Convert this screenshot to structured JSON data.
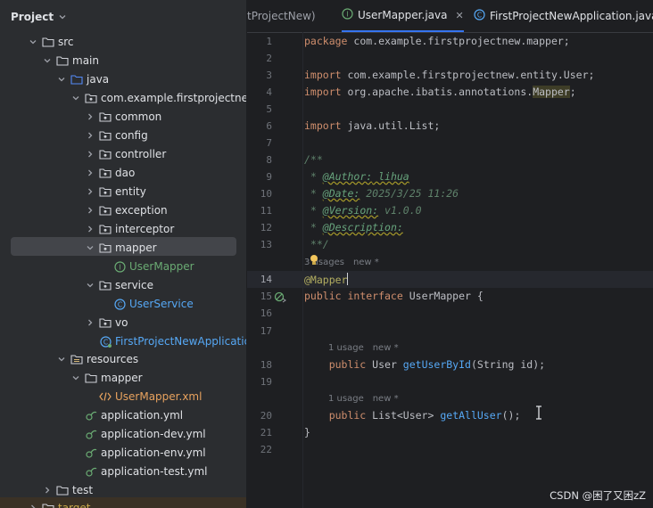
{
  "project": {
    "title": "Project",
    "tree": [
      {
        "label": "src",
        "kind": "folder",
        "expanded": true
      },
      {
        "label": "main",
        "kind": "folder",
        "expanded": true
      },
      {
        "label": "java",
        "kind": "source-folder",
        "expanded": true
      },
      {
        "label": "com.example.firstprojectnew",
        "kind": "package",
        "expanded": true
      },
      {
        "label": "common",
        "kind": "package",
        "expanded": false
      },
      {
        "label": "config",
        "kind": "package",
        "expanded": false
      },
      {
        "label": "controller",
        "kind": "package",
        "expanded": false
      },
      {
        "label": "dao",
        "kind": "package",
        "expanded": false
      },
      {
        "label": "entity",
        "kind": "package",
        "expanded": false
      },
      {
        "label": "exception",
        "kind": "package",
        "expanded": false
      },
      {
        "label": "interceptor",
        "kind": "package",
        "expanded": false
      },
      {
        "label": "mapper",
        "kind": "package",
        "expanded": true
      },
      {
        "label": "UserMapper",
        "kind": "interface"
      },
      {
        "label": "service",
        "kind": "package",
        "expanded": true
      },
      {
        "label": "UserService",
        "kind": "class"
      },
      {
        "label": "vo",
        "kind": "package",
        "expanded": false
      },
      {
        "label": "FirstProjectNewApplication",
        "kind": "app-class"
      },
      {
        "label": "resources",
        "kind": "resources-folder",
        "expanded": true
      },
      {
        "label": "mapper",
        "kind": "folder",
        "expanded": true
      },
      {
        "label": "UserMapper.xml",
        "kind": "xml"
      },
      {
        "label": "application.yml",
        "kind": "yml"
      },
      {
        "label": "application-dev.yml",
        "kind": "yml"
      },
      {
        "label": "application-env.yml",
        "kind": "yml"
      },
      {
        "label": "application-test.yml",
        "kind": "yml"
      },
      {
        "label": "test",
        "kind": "folder",
        "expanded": false
      },
      {
        "label": "target",
        "kind": "folder",
        "expanded": false
      }
    ]
  },
  "tabs": [
    {
      "label": "tProjectNew)"
    },
    {
      "label": "UserMapper.java",
      "close": "✕"
    },
    {
      "label": "FirstProjectNewApplication.java"
    }
  ],
  "code": {
    "line_numbers": [
      "1",
      "2",
      "3",
      "4",
      "5",
      "6",
      "7",
      "8",
      "9",
      "10",
      "11",
      "12",
      "13",
      "14",
      "15",
      "16",
      "17",
      "18",
      "19",
      "20",
      "21",
      "22"
    ],
    "l1_kw": "package",
    "l1_rest": " com.example.firstprojectnew.mapper;",
    "l3_kw": "import",
    "l3_rest": " com.example.firstprojectnew.entity.User;",
    "l4_kw": "import",
    "l4_pre": " org.apache.ibatis.annotations.",
    "l4_hl": "Mapper",
    "l4_end": ";",
    "l6_kw": "import",
    "l6_rest": " java.util.List;",
    "l8": "/**",
    "l9_star": " * ",
    "l9_tag": "@Author:",
    "l9_val": " lihua",
    "l10_star": " * ",
    "l10_tag": "@Date:",
    "l10_val": " 2025/3/25 11:26",
    "l11_star": " * ",
    "l11_tag": "@Version:",
    "l11_val": " v1.0.0",
    "l12_star": " * ",
    "l12_tag": "@Description:",
    "l13": " **/",
    "usages_a": "3 usages",
    "new_a": "new *",
    "l14": "@Mapper",
    "l15_kw1": "public",
    "l15_kw2": " interface",
    "l15_rest": " UserMapper {",
    "usages_b": "1 usage",
    "new_b": "new *",
    "l18_kw": "    public",
    "l18_type": " User ",
    "l18_fn": "getUserById",
    "l18_rest": "(String id);",
    "usages_c": "1 usage",
    "new_c": "new *",
    "l20_kw": "    public",
    "l20_type": " List<User> ",
    "l20_fn": "getAllUser",
    "l20_rest": "();",
    "l21": "}"
  },
  "watermark": "CSDN @困了又困zZ",
  "colors": {
    "accent": "#3574f0",
    "keyword": "#cf8e6d",
    "function": "#56a8f5",
    "annotation": "#b3ae60"
  }
}
